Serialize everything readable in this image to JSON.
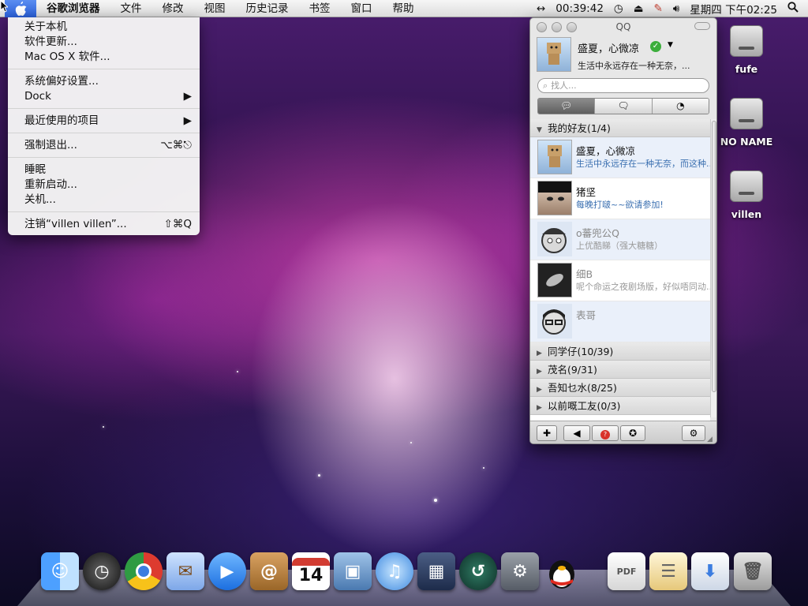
{
  "menubar": {
    "app_name": "谷歌浏览器",
    "items": [
      "文件",
      "修改",
      "视图",
      "历史记录",
      "书签",
      "窗口",
      "帮助"
    ],
    "timer": "00:39:42",
    "clock": "星期四 下午02:25"
  },
  "apple_menu": {
    "about": "关于本机",
    "software_update": "软件更新...",
    "mac_software": "Mac OS X 软件...",
    "system_prefs": "系统偏好设置...",
    "dock": "Dock",
    "recent_items": "最近使用的项目",
    "force_quit": "强制退出...",
    "force_quit_shortcut": "⌥⌘⎋",
    "sleep": "睡眠",
    "restart": "重新启动...",
    "shutdown": "关机...",
    "logout": "注销“villen villen”...",
    "logout_shortcut": "⇧⌘Q"
  },
  "desktop": {
    "drives": [
      "fufe",
      "NO NAME",
      "villen"
    ]
  },
  "qq": {
    "title": "QQ",
    "me": {
      "name": "盛夏，心微凉",
      "signature": "生活中永远存在一种无奈，..."
    },
    "search_placeholder": "找人...",
    "groups": {
      "friends": "我的好友(1/4)",
      "classmates": "同学仔(10/39)",
      "maoming": "茂名(9/31)",
      "wuzhi": "吾知乜水(8/25)",
      "coworkers": "以前嘅工友(0/3)"
    },
    "friends": [
      {
        "name": "盛夏，心微凉",
        "signature": "生活中永远存在一种无奈，而这种..."
      },
      {
        "name": "猪坚",
        "signature": "每晚打啵~~欲请参加!"
      },
      {
        "name": "o蕃兜公Q",
        "signature": "上优酷睇（强大糖糖）"
      },
      {
        "name": "细B",
        "signature": "呢个命运之夜剧场版，好似唔同动..."
      },
      {
        "name": "表哥",
        "signature": ""
      }
    ]
  },
  "dock": {
    "calendar_day": "14"
  }
}
